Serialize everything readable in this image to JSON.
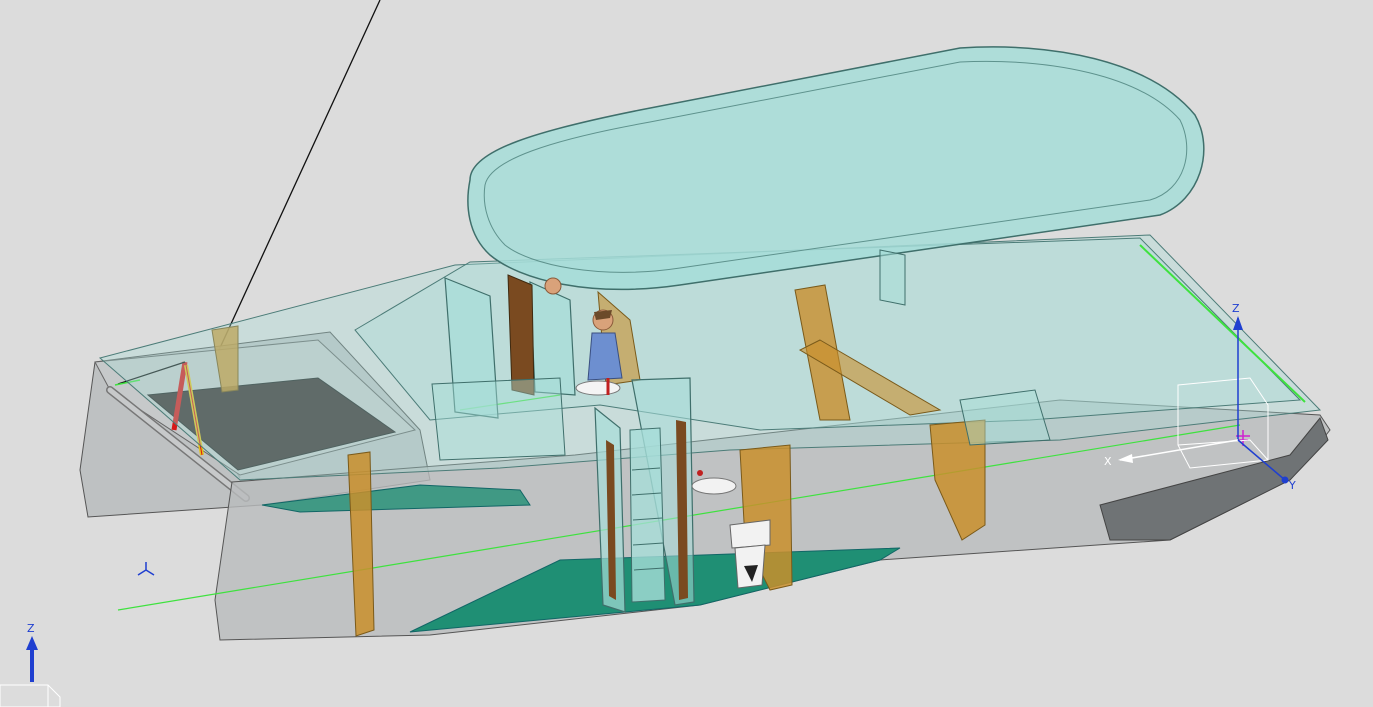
{
  "viewport": {
    "background": "#dcdcdc"
  },
  "triad_main": {
    "z_label": "Z",
    "x_label": "X",
    "y_label": "Y"
  },
  "triad_corner": {
    "z_label": "Z"
  },
  "colors": {
    "hull": "#b9bcbd",
    "glass": "#a6ddd8",
    "bulkhead": "#c98f2c",
    "floor": "#1f8f74",
    "net": "#3b2f2e",
    "guide_line": "#3ee23e",
    "axis_z": "#1f3fd0",
    "axis_y": "#1f3fd0",
    "mast": "#d81818",
    "rope": "#111111",
    "marker": "#d020d0"
  }
}
